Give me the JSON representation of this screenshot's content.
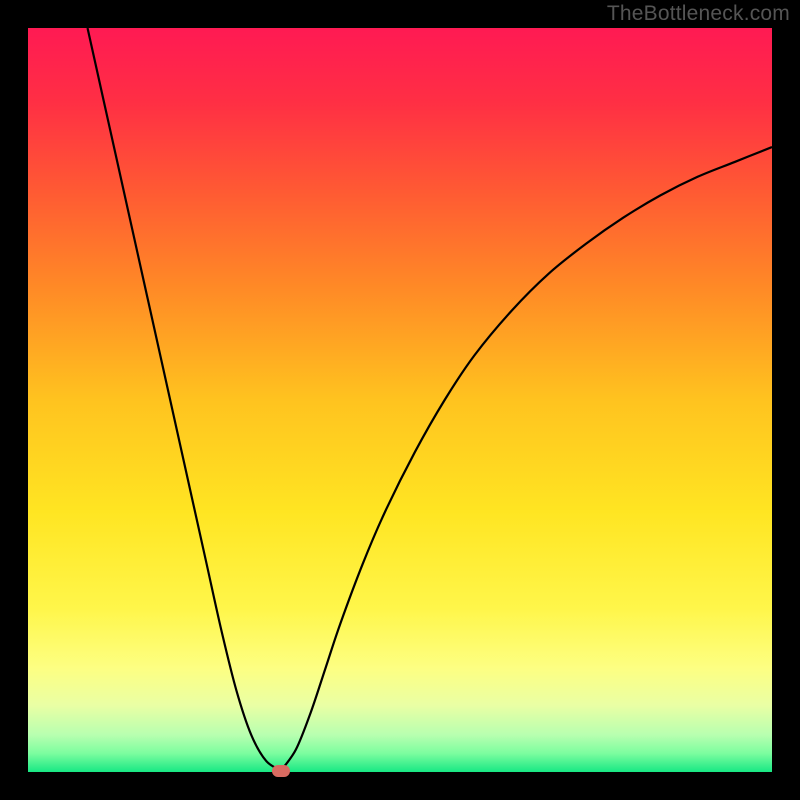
{
  "watermark": "TheBottleneck.com",
  "chart_data": {
    "type": "line",
    "title": "",
    "xlabel": "",
    "ylabel": "",
    "xlim": [
      0,
      100
    ],
    "ylim": [
      0,
      100
    ],
    "series": [
      {
        "name": "left-branch",
        "x": [
          8,
          10,
          12,
          14,
          16,
          18,
          20,
          22,
          24,
          26,
          28,
          30,
          32,
          34
        ],
        "values": [
          100,
          91,
          82,
          73,
          64,
          55,
          46,
          37,
          28,
          19,
          11,
          5,
          1.5,
          0.2
        ]
      },
      {
        "name": "right-branch",
        "x": [
          34,
          36,
          38,
          40,
          42,
          45,
          48,
          52,
          56,
          60,
          65,
          70,
          75,
          80,
          85,
          90,
          95,
          100
        ],
        "values": [
          0.2,
          3,
          8,
          14,
          20,
          28,
          35,
          43,
          50,
          56,
          62,
          67,
          71,
          74.5,
          77.5,
          80,
          82,
          84
        ]
      }
    ],
    "marker": {
      "x": 34,
      "y": 0.2
    },
    "gradient_stops": [
      {
        "pos": 0.0,
        "color": "#ff1a53"
      },
      {
        "pos": 0.1,
        "color": "#ff2f44"
      },
      {
        "pos": 0.22,
        "color": "#ff5a33"
      },
      {
        "pos": 0.35,
        "color": "#ff8a26"
      },
      {
        "pos": 0.5,
        "color": "#ffc31f"
      },
      {
        "pos": 0.65,
        "color": "#ffe522"
      },
      {
        "pos": 0.78,
        "color": "#fff64a"
      },
      {
        "pos": 0.86,
        "color": "#fdff82"
      },
      {
        "pos": 0.91,
        "color": "#eaffa4"
      },
      {
        "pos": 0.95,
        "color": "#b8ffb0"
      },
      {
        "pos": 0.975,
        "color": "#7cfd9f"
      },
      {
        "pos": 1.0,
        "color": "#18e884"
      }
    ]
  }
}
